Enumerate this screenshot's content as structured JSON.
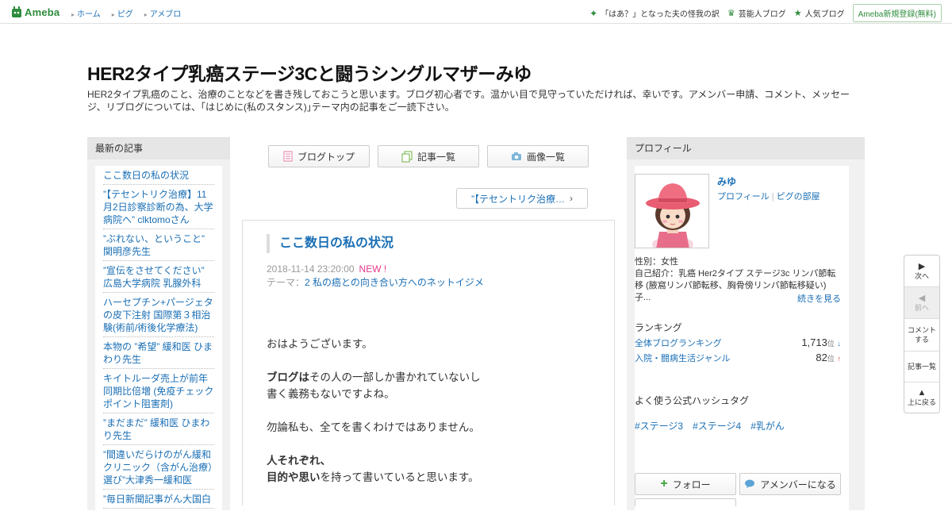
{
  "header": {
    "logo": "Ameba",
    "nav": [
      "ホーム",
      "ピグ",
      "アメブロ"
    ],
    "right_links": [
      "「はあ？」となった夫の怪我の訳",
      "芸能人ブログ",
      "人気ブログ"
    ],
    "register": "Ameba新規登録(無料)"
  },
  "blog": {
    "title": "HER2タイプ乳癌ステージ3Cと闘うシングルマザーみゆ",
    "description": "HER2タイプ乳癌のこと、治療のことなどを書き残しておこうと思います。ブログ初心者です。温かい目で見守っていただければ、幸いです。アメンバー申請、コメント、メッセージ、リブログについては、｢はじめに(私のスタンス)｣テーマ内の記事をご一読下さい。"
  },
  "recent": {
    "heading": "最新の記事",
    "items": [
      "ここ数日の私の状況",
      "”【テセントリク治療】11月2日診察診断の為、大学病院へ” clktomoさん",
      "”ぶれない、ということ” 関明彦先生",
      "”宣伝をさせてください” 広島大学病院 乳腺外科",
      "ハーセプチン+パージェタの皮下注射 国際第３相治験(術前/術後化学療法)",
      "本物の ”希望” 緩和医 ひまわり先生",
      "キイトルーダ売上が前年同期比倍増 (免疫チェックポイント阻害剤)",
      "”まだまだ” 緩和医 ひまわり先生",
      "”間違いだらけのがん緩和クリニック（含がん治療）選び”大津秀一緩和医",
      "”毎日新聞記事がん大国白"
    ]
  },
  "center": {
    "buttons": [
      "ブログトップ",
      "記事一覧",
      "画像一覧"
    ],
    "prev_link": "”【テセントリク治療…"
  },
  "article": {
    "title": "ここ数日の私の状況",
    "date": "2018-11-14 23:20:00",
    "new_badge": "NEW !",
    "theme_label": "テーマ：",
    "theme": "2 私の癌との向き合い方へのネットイジメ",
    "p1": "おはようございます。",
    "p2_bold": "ブログは",
    "p2_rest": "その人の一部しか書かれていないし",
    "p2_line2": "書く義務もないですよね。",
    "p3": "勿論私も、全てを書くわけではありません。",
    "p4_line1": "人それぞれ、",
    "p4_bold": "目的や思い",
    "p4_rest": "を持って書いていると思います。"
  },
  "profile": {
    "heading": "プロフィール",
    "name": "みゆ",
    "link_profile": "プロフィール",
    "link_room": "ピグの部屋",
    "gender": "性別：女性",
    "intro": "自己紹介：乳癌 Her2タイプ ステージ3c リンパ節転移 (腋窩リンパ節転移、胸骨傍リンパ節転移疑い) 子...",
    "more": "続きを見る",
    "ranking_heading": "ランキング",
    "ranking": [
      {
        "label": "全体ブログランキング",
        "value": "1,713",
        "unit": "位",
        "trend": "↓"
      },
      {
        "label": "入院・闘病生活ジャンル",
        "value": "82",
        "unit": "位",
        "trend": "↑"
      }
    ],
    "hashtag_heading": "よく使う公式ハッシュタグ",
    "hashtags": [
      "#ステージ3",
      "#ステージ4",
      "#乳がん"
    ],
    "follow": "フォロー",
    "amember": "アメンバーになる"
  },
  "sidenav": {
    "next": "次へ",
    "prev": "前へ",
    "comment": "コメントする",
    "list": "記事一覧",
    "top": "上に戻る"
  },
  "colors": {
    "brand": "#2d8c3c",
    "link": "#1a6fb5",
    "new": "#e73a8c"
  }
}
